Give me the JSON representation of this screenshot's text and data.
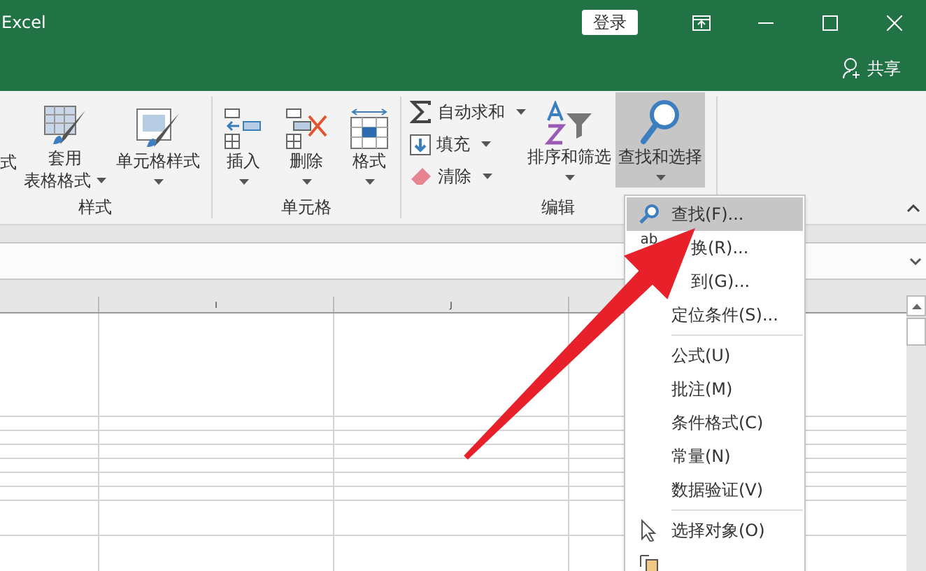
{
  "title_bar": {
    "title": "Excel",
    "login": "登录",
    "share": "共享"
  },
  "ribbon": {
    "cut_command": "式",
    "groups": [
      {
        "label": "样式",
        "commands": [
          {
            "kind": "table",
            "lines": [
              "套用",
              "表格格式"
            ],
            "dropdown": true
          },
          {
            "kind": "cellstyle",
            "lines": [
              "单元格样式"
            ],
            "dropdown": true
          }
        ]
      },
      {
        "label": "单元格",
        "commands": [
          {
            "kind": "insert",
            "lines": [
              "插入"
            ],
            "dropdown": true
          },
          {
            "kind": "delete",
            "lines": [
              "删除"
            ],
            "dropdown": true
          },
          {
            "kind": "format",
            "lines": [
              "格式"
            ],
            "dropdown": true
          }
        ]
      },
      {
        "label": "编辑",
        "small": [
          {
            "kind": "sum",
            "label": "自动求和",
            "dropdown": true
          },
          {
            "kind": "fill",
            "label": "填充",
            "dropdown": true
          },
          {
            "kind": "clear",
            "label": "清除",
            "dropdown": true
          }
        ],
        "commands": [
          {
            "kind": "sort",
            "lines": [
              "排序和筛选"
            ],
            "dropdown": true
          },
          {
            "kind": "find",
            "lines": [
              "查找和选择"
            ],
            "dropdown": true,
            "pressed": true
          }
        ]
      }
    ]
  },
  "sheet": {
    "columns": [
      {},
      {
        "label": "I"
      },
      {
        "label": "J"
      },
      {}
    ]
  },
  "menu": {
    "items": [
      {
        "kind": "find",
        "label": "查找(F)...",
        "highlighted": true
      },
      {
        "kind": "replace",
        "icon_text": "ab",
        "label": "换(R)...",
        "highlighted": false
      },
      {
        "kind": "covered",
        "label": "到(G)...",
        "highlighted": false
      },
      {
        "kind": "plain",
        "label": "定位条件(S)...",
        "highlighted": false
      },
      {
        "kind": "separator"
      },
      {
        "kind": "plain",
        "label": "公式(U)",
        "highlighted": false
      },
      {
        "kind": "plain",
        "label": "批注(M)",
        "highlighted": false
      },
      {
        "kind": "plain",
        "label": "条件格式(C)",
        "highlighted": false
      },
      {
        "kind": "plain",
        "label": "常量(N)",
        "highlighted": false
      },
      {
        "kind": "plain",
        "label": "数据验证(V)",
        "highlighted": false
      },
      {
        "kind": "separator"
      },
      {
        "kind": "select",
        "label": "选择对象(O)",
        "highlighted": false
      },
      {
        "kind": "pane",
        "highlighted": false
      }
    ]
  }
}
